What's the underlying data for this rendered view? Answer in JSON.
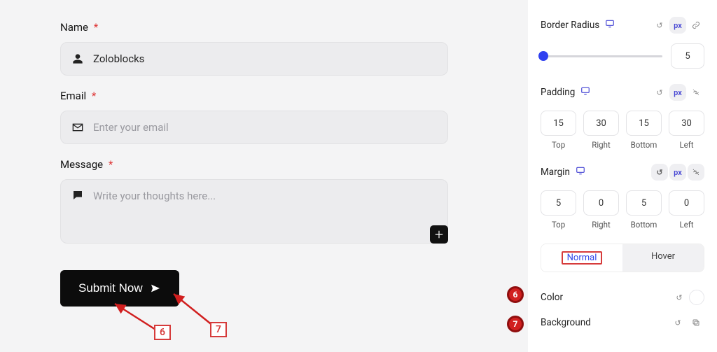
{
  "form": {
    "name": {
      "label": "Name",
      "value": "Zoloblocks"
    },
    "email": {
      "label": "Email",
      "placeholder": "Enter your email"
    },
    "message": {
      "label": "Message",
      "placeholder": "Write your thoughts here..."
    },
    "submit_label": "Submit Now"
  },
  "sidebar": {
    "border_radius": {
      "label": "Border Radius",
      "unit": "px",
      "value": "5"
    },
    "padding": {
      "label": "Padding",
      "unit": "px",
      "top": "15",
      "right": "30",
      "bottom": "15",
      "left": "30",
      "sides": {
        "top": "Top",
        "right": "Right",
        "bottom": "Bottom",
        "left": "Left"
      }
    },
    "margin": {
      "label": "Margin",
      "unit": "px",
      "top": "5",
      "right": "0",
      "bottom": "5",
      "left": "0",
      "sides": {
        "top": "Top",
        "right": "Right",
        "bottom": "Bottom",
        "left": "Left"
      }
    },
    "tabs": {
      "normal": "Normal",
      "hover": "Hover"
    },
    "color_label": "Color",
    "background_label": "Background"
  },
  "annotations": {
    "six": "6",
    "seven": "7"
  }
}
